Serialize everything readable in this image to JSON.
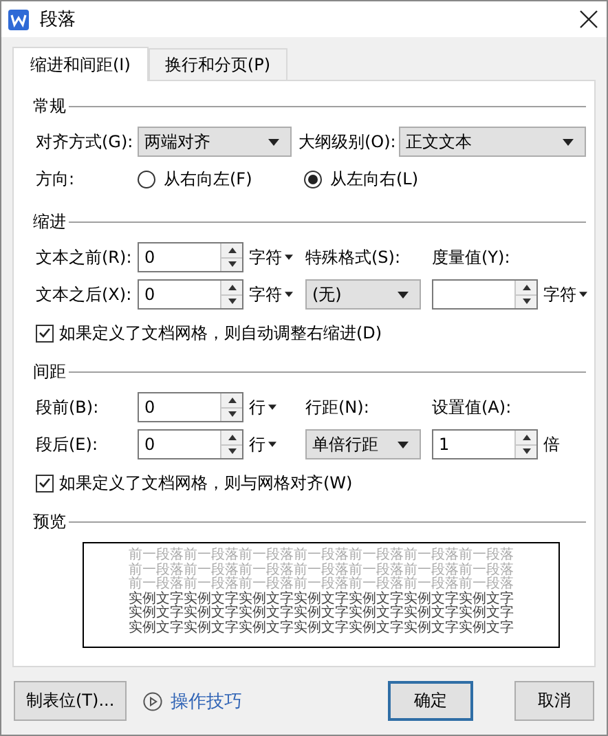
{
  "window": {
    "title": "段落"
  },
  "tabs": [
    {
      "label": "缩进和间距(I)",
      "selected": true
    },
    {
      "label": "换行和分页(P)",
      "selected": false
    }
  ],
  "general": {
    "heading": "常规",
    "alignment": {
      "label": "对齐方式(G):",
      "value": "两端对齐"
    },
    "outline_level": {
      "label": "大纲级别(O):",
      "value": "正文文本"
    },
    "direction": {
      "label": "方向:",
      "options": [
        {
          "label": "从右向左(F)",
          "selected": false
        },
        {
          "label": "从左向右(L)",
          "selected": true
        }
      ]
    }
  },
  "indent": {
    "heading": "缩进",
    "before_text": {
      "label": "文本之前(R):",
      "value": "0",
      "unit": "字符"
    },
    "after_text": {
      "label": "文本之后(X):",
      "value": "0",
      "unit": "字符"
    },
    "special": {
      "label": "特殊格式(S):",
      "value": "(无)"
    },
    "measure": {
      "label": "度量值(Y):",
      "unit": "字符"
    },
    "auto_adjust": {
      "label": "如果定义了文档网格，则自动调整右缩进(D)",
      "checked": true
    }
  },
  "spacing": {
    "heading": "间距",
    "before": {
      "label": "段前(B):",
      "value": "0",
      "unit": "行"
    },
    "after": {
      "label": "段后(E):",
      "value": "0",
      "unit": "行"
    },
    "line_spacing": {
      "label": "行距(N):",
      "value": "单倍行距"
    },
    "set_value": {
      "label": "设置值(A):",
      "value": "1",
      "unit": "倍"
    },
    "snap_to_grid": {
      "label": "如果定义了文档网格，则与网格对齐(W)",
      "checked": true
    }
  },
  "preview": {
    "heading": "预览",
    "lines": [
      {
        "kind": "previous",
        "text": "前一段落前一段落前一段落前一段落前一段落前一段落前一段落"
      },
      {
        "kind": "previous",
        "text": "前一段落前一段落前一段落前一段落前一段落前一段落前一段落"
      },
      {
        "kind": "previous",
        "text": "前一段落前一段落前一段落前一段落前一段落前一段落前一段落"
      },
      {
        "kind": "sample",
        "text": "实例文字实例文字实例文字实例文字实例文字实例文字实例文字"
      },
      {
        "kind": "sample",
        "text": "实例文字实例文字实例文字实例文字实例文字实例文字实例文字"
      },
      {
        "kind": "sample",
        "text": "实例文字实例文字实例文字实例文字实例文字实例文字实例文字"
      }
    ]
  },
  "footer": {
    "tab_stops": "制表位(T)...",
    "tips": "操作技巧",
    "ok": "确定",
    "cancel": "取消"
  }
}
